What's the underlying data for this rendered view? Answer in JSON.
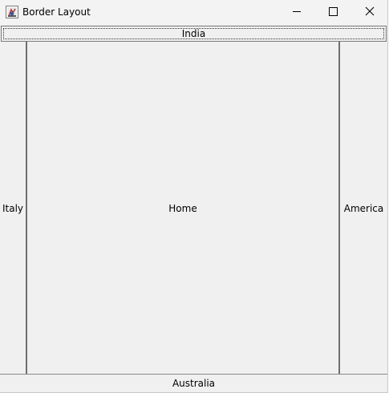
{
  "window": {
    "title": "Border Layout"
  },
  "icons": {
    "app": "java-app-icon",
    "minimize": "minimize-icon",
    "maximize": "maximize-icon",
    "close": "close-icon"
  },
  "regions": {
    "north": "India",
    "west": "Italy",
    "center": "Home",
    "east": "America",
    "south": "Australia"
  }
}
